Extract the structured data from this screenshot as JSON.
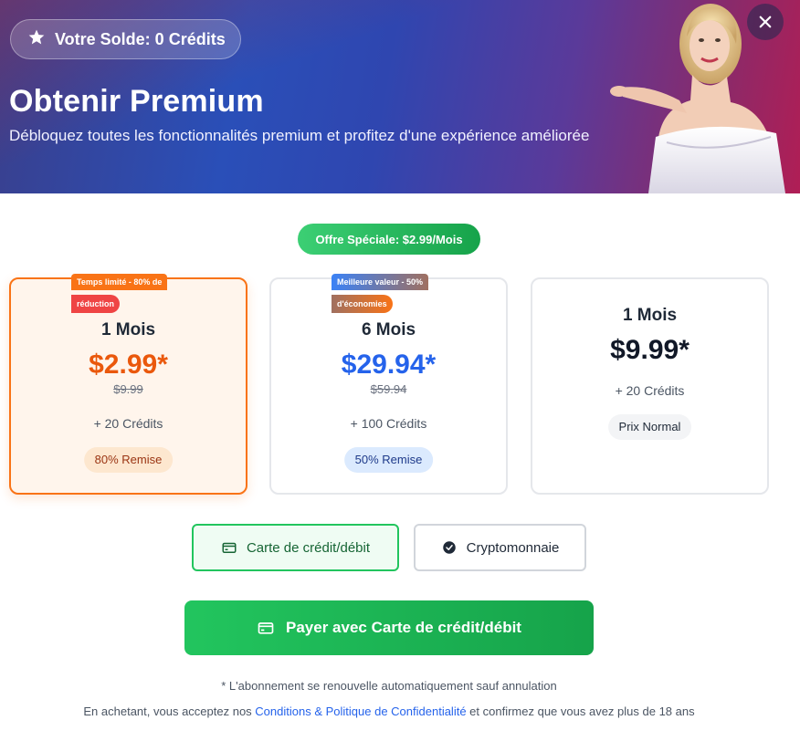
{
  "header": {
    "balance_label": "Votre Solde: 0 Crédits",
    "title": "Obtenir Premium",
    "subtitle": "Débloquez toutes les fonctionnalités premium et profitez d'une expérience améliorée"
  },
  "special_offer": "Offre Spéciale: $2.99/Mois",
  "plans": [
    {
      "ribbon_line1": "Temps limité - 80% de",
      "ribbon_line2": "réduction",
      "name": "1 Mois",
      "price": "$2.99*",
      "old_price": "$9.99",
      "credits": "+ 20 Crédits",
      "badge": "80% Remise",
      "color": "#ea580c"
    },
    {
      "ribbon_line1": "Meilleure valeur - 50%",
      "ribbon_line2": "d'économies",
      "name": "6 Mois",
      "price": "$29.94*",
      "old_price": "$59.94",
      "credits": "+ 100 Crédits",
      "badge": "50% Remise",
      "color": "#2563eb"
    },
    {
      "name": "1 Mois",
      "price": "$9.99*",
      "credits": "+ 20 Crédits",
      "badge": "Prix Normal",
      "color": "#111827"
    }
  ],
  "payment_methods": {
    "card_label": "Carte de crédit/débit",
    "crypto_label": "Cryptomonnaie",
    "selected": "card"
  },
  "pay_button": "Payer avec Carte de crédit/débit",
  "footnote": "* L'abonnement se renouvelle automatiquement sauf annulation",
  "legal": {
    "prefix": "En achetant, vous acceptez nos ",
    "link": "Conditions & Politique de Confidentialité",
    "suffix": " et confirmez que vous avez plus de 18 ans"
  },
  "icons": {
    "balance": "star-icon",
    "close": "close-icon",
    "card": "credit-card-icon",
    "crypto": "check-circle-icon"
  }
}
